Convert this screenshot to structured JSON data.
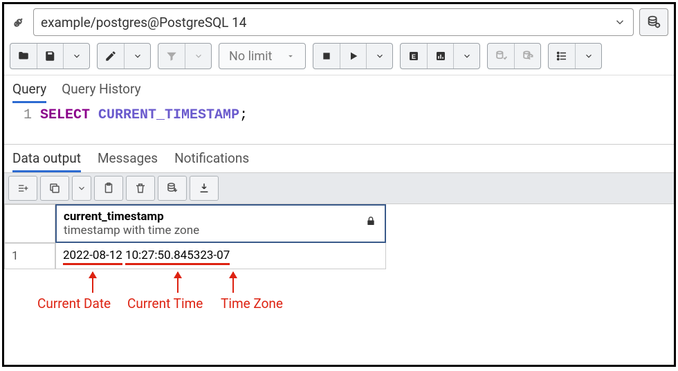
{
  "connection": {
    "label": "example/postgres@PostgreSQL 14"
  },
  "toolbar": {
    "limit_label": "No limit"
  },
  "query_tabs": {
    "query": "Query",
    "history": "Query History"
  },
  "editor": {
    "line_number": "1",
    "kw_select": "SELECT",
    "kw_func": "CURRENT_TIMESTAMP",
    "stmt_end": ";"
  },
  "output_tabs": {
    "data": "Data output",
    "messages": "Messages",
    "notifications": "Notifications"
  },
  "grid": {
    "column_name": "current_timestamp",
    "column_type": "timestamp with time zone",
    "row_number": "1",
    "value_date": "2022-08-12",
    "value_time": "10:27:50.845323",
    "value_tz": "-07"
  },
  "annotations": {
    "date": "Current Date",
    "time": "Current Time",
    "tz": "Time Zone"
  }
}
